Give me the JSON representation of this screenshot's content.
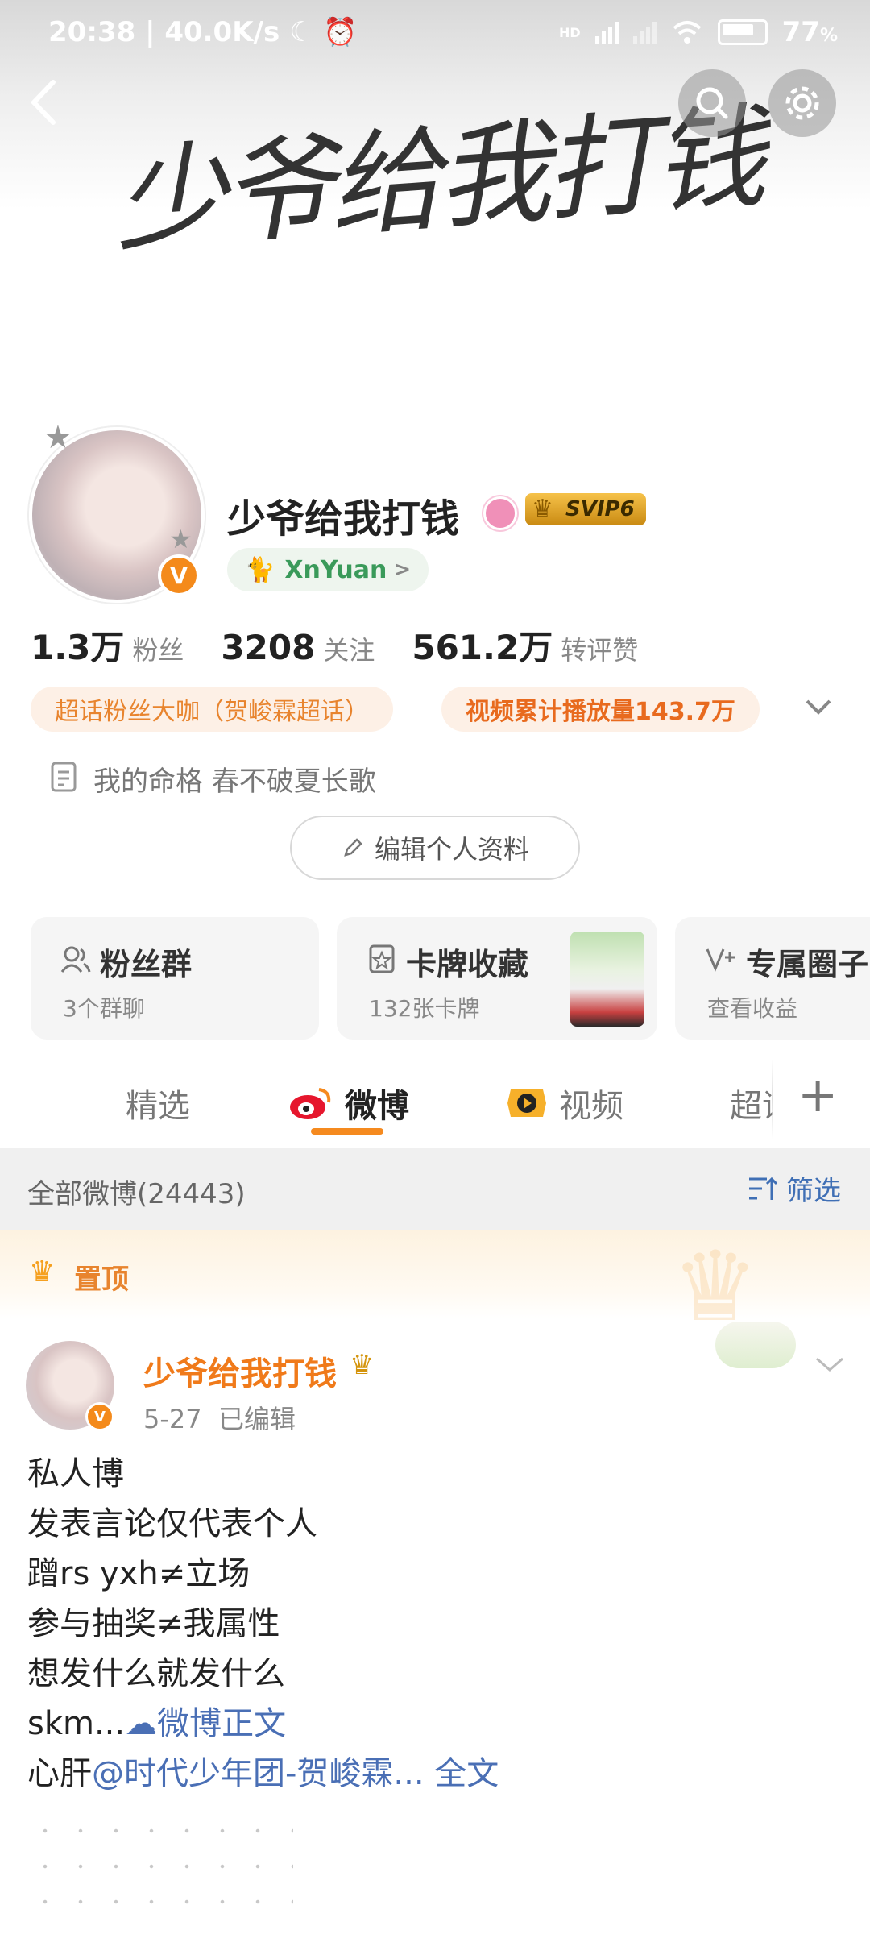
{
  "status_bar": {
    "time": "20:38",
    "speed": "40.0K/s",
    "hd": "HD",
    "battery": "77",
    "battery_unit": "%"
  },
  "header": {
    "cover_text": "少爷给我打钱"
  },
  "profile": {
    "name": "少爷给我打钱",
    "svip_label": "SVIP6",
    "tag": "XnYuan",
    "tag_arrow": ">",
    "verified_mark": "V",
    "stats": [
      {
        "value": "1.3万",
        "label": "粉丝"
      },
      {
        "value": "3208",
        "label": "关注"
      },
      {
        "value": "561.2万",
        "label": "转评赞"
      }
    ],
    "badges": [
      "超话粉丝大咖（贺峻霖超话）",
      "视频累计播放量143.7万"
    ],
    "bio": "我的命格 春不破夏长歌",
    "edit_label": "编辑个人资料"
  },
  "cards": [
    {
      "title": "粉丝群",
      "sub": "3个群聊"
    },
    {
      "title": "卡牌收藏",
      "sub": "132张卡牌"
    },
    {
      "title": "专属圈子",
      "sub": "查看收益"
    }
  ],
  "tabs": {
    "t1": "精选",
    "t2": "微博",
    "t3": "视频",
    "t4": "超话",
    "add": "+"
  },
  "feed_header": {
    "all": "全部微博(24443)",
    "filter": "筛选"
  },
  "pinned": {
    "label": "置顶"
  },
  "post": {
    "author": "少爷给我打钱",
    "date": "5-27",
    "edited": "已编辑",
    "lines": {
      "l1": "私人博",
      "l2": "发表言论仅代表个人",
      "l3": "蹭rs yxh≠立场",
      "l4": "参与抽奖≠我属性",
      "l5": "想发什么就发什么",
      "l6a": "skm...",
      "l6b": "微博正文",
      "l7a": "心肝",
      "l7b": "@时代少年团-贺峻霖...",
      "l7c": " 全文"
    }
  },
  "colors": {
    "accent": "#f58a1f",
    "link": "#4a6fb5",
    "badge_bg": "#fdf0e6",
    "badge_text": "#e8842e"
  }
}
